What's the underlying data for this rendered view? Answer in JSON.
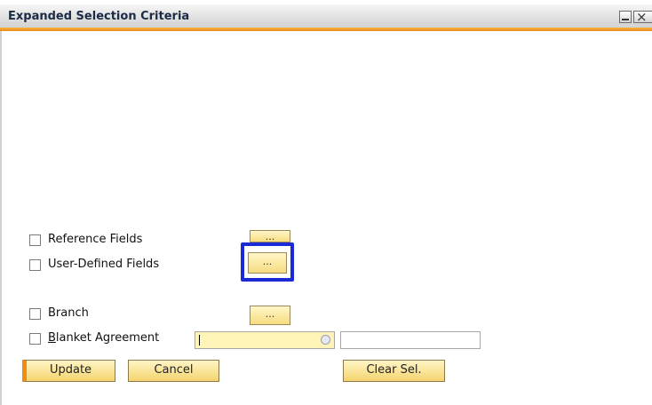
{
  "window": {
    "title": "Expanded Selection Criteria"
  },
  "options": {
    "reference_fields": "Reference Fields",
    "user_defined_fields": "User-Defined Fields",
    "branch": "Branch",
    "blanket_agreement_prefix": "B",
    "blanket_agreement_rest": "lanket Agreement",
    "ellipsis": "..."
  },
  "buttons": {
    "update": "Update",
    "cancel": "Cancel",
    "clear": "Clear Sel."
  },
  "colors": {
    "accent_orange": "#ee8d14",
    "button_yellow": "#f7dc80",
    "focus_blue": "#1a2bd6",
    "input_yellow": "#fff4b8"
  },
  "icons": {
    "minimize": "minimize-icon",
    "close": "close-icon",
    "picker": "picker-icon"
  }
}
